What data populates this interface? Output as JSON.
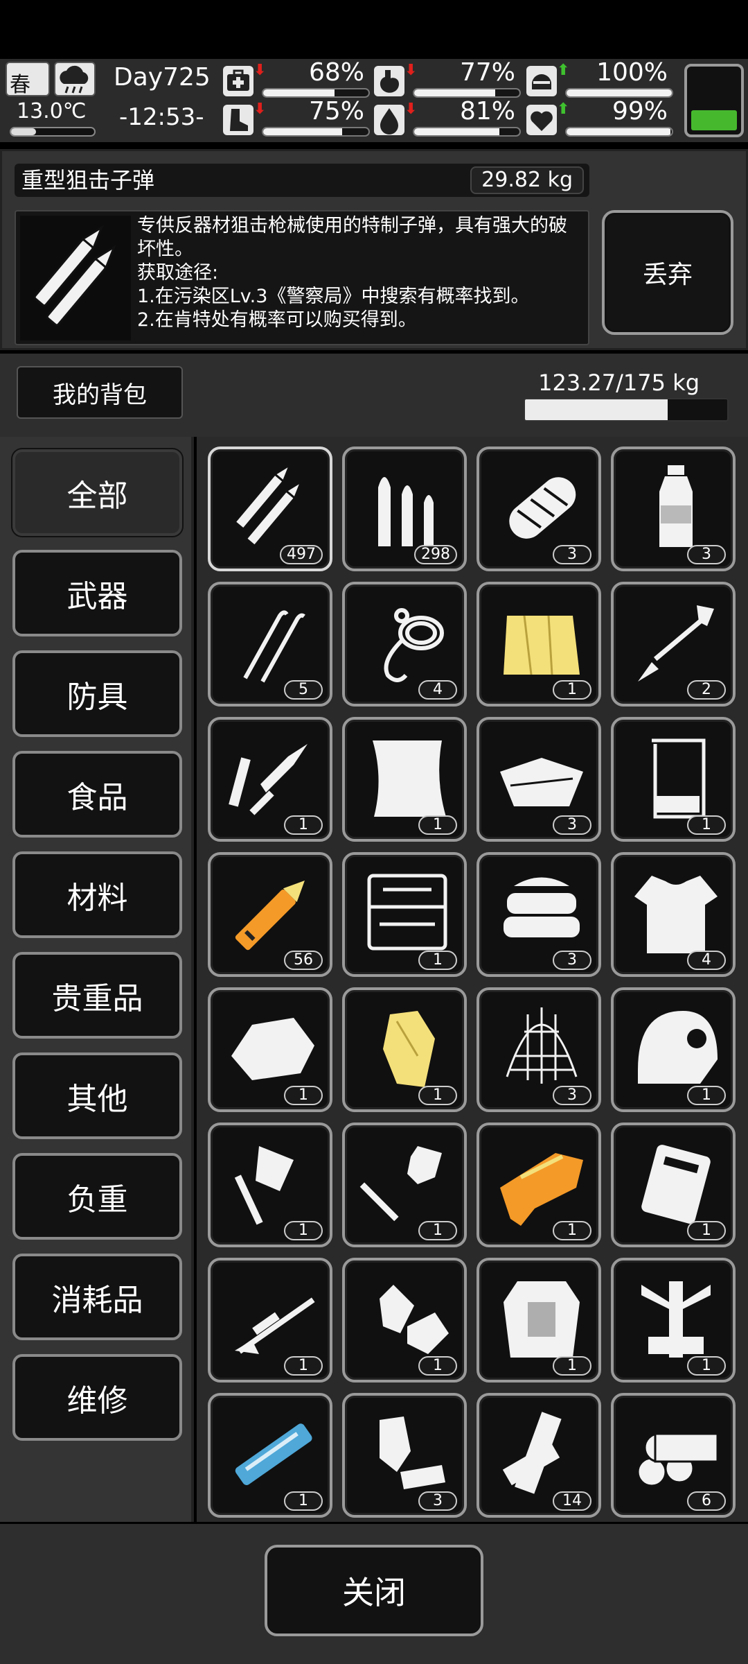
{
  "status": {
    "season": "春",
    "weather_icon": "cloud-rain-icon",
    "temperature": "13.0℃",
    "day": "Day725",
    "clock": "-12:53-",
    "stats": [
      {
        "name": "health",
        "icon": "medkit-icon",
        "arrow": "down",
        "percent": "68%",
        "value": 68
      },
      {
        "name": "hunger",
        "icon": "stomach-icon",
        "arrow": "down",
        "percent": "77%",
        "value": 77
      },
      {
        "name": "defense",
        "icon": "helmet-icon",
        "arrow": "up",
        "percent": "100%",
        "value": 100
      },
      {
        "name": "stamina",
        "icon": "boot-icon",
        "arrow": "down",
        "percent": "75%",
        "value": 75
      },
      {
        "name": "thirst",
        "icon": "water-drop-icon",
        "arrow": "down",
        "percent": "81%",
        "value": 81
      },
      {
        "name": "mood",
        "icon": "heart-icon",
        "arrow": "up",
        "percent": "99%",
        "value": 99
      }
    ],
    "battery_level": 0.3,
    "colors": {
      "arrow_down": "#e0201c",
      "arrow_up": "#3fc12f",
      "battery": "#46b82e"
    }
  },
  "detail": {
    "name": "重型狙击子弹",
    "weight": "29.82 kg",
    "icon": "sniper-bullets-icon",
    "description": "专供反器材狙击枪械使用的特制子弹，具有强大的破坏性。\n获取途径:\n1.在污染区Lv.3《警察局》中搜索有概率找到。\n2.在肯特处有概率可以购买得到。",
    "discard_label": "丢弃"
  },
  "bag": {
    "tab_label": "我的背包",
    "weight": "123.27/175 kg",
    "fill": 0.704
  },
  "categories": [
    "全部",
    "武器",
    "防具",
    "食品",
    "材料",
    "贵重品",
    "其他",
    "负重",
    "消耗品",
    "维修"
  ],
  "active_category": 0,
  "items": [
    {
      "icon": "sniper-bullets-icon",
      "count": "497"
    },
    {
      "icon": "rifle-bullets-icon",
      "count": "298"
    },
    {
      "icon": "bread-icon",
      "count": "3"
    },
    {
      "icon": "water-bottle-icon",
      "count": "3"
    },
    {
      "icon": "lockpick-icon",
      "count": "5"
    },
    {
      "icon": "rope-icon",
      "count": "4"
    },
    {
      "icon": "yellow-cloth-icon",
      "count": "1"
    },
    {
      "icon": "arrow-icon",
      "count": "2"
    },
    {
      "icon": "soldering-iron-icon",
      "count": "1"
    },
    {
      "icon": "towel-icon",
      "count": "1"
    },
    {
      "icon": "cloth-scraps-icon",
      "count": "3"
    },
    {
      "icon": "beaker-icon",
      "count": "1"
    },
    {
      "icon": "syringe-icon",
      "count": "56"
    },
    {
      "icon": "toolkit-icon",
      "count": "1"
    },
    {
      "icon": "folded-cloth-icon",
      "count": "3"
    },
    {
      "icon": "torn-shirt-icon",
      "count": "4"
    },
    {
      "icon": "ore-rock-icon",
      "count": "1"
    },
    {
      "icon": "gold-crystal-icon",
      "count": "1"
    },
    {
      "icon": "net-icon",
      "count": "3"
    },
    {
      "icon": "tactical-helmet-icon",
      "count": "1"
    },
    {
      "icon": "axe-icon",
      "count": "1"
    },
    {
      "icon": "shovel-icon",
      "count": "1"
    },
    {
      "icon": "orange-gun-icon",
      "count": "1"
    },
    {
      "icon": "case-icon",
      "count": "1"
    },
    {
      "icon": "sniper-rifle-icon",
      "count": "1"
    },
    {
      "icon": "gloves-icon",
      "count": "1"
    },
    {
      "icon": "body-armor-icon",
      "count": "1"
    },
    {
      "icon": "exoskeleton-icon",
      "count": "1"
    },
    {
      "icon": "minigun-icon",
      "count": "1"
    },
    {
      "icon": "leather-pieces-icon",
      "count": "3"
    },
    {
      "icon": "wood-planks-icon",
      "count": "14"
    },
    {
      "icon": "logs-icon",
      "count": "6"
    }
  ],
  "close_label": "关闭"
}
